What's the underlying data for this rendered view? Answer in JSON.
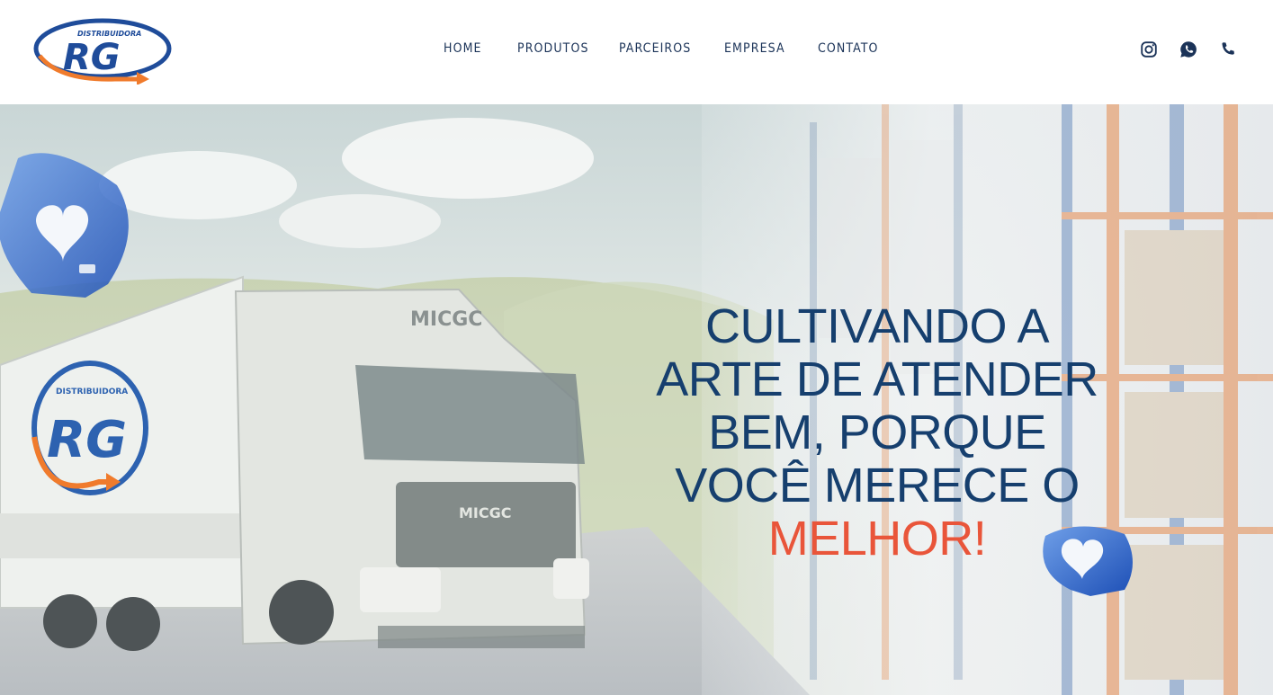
{
  "brand": {
    "logo_top_text": "DISTRIBUIDORA",
    "logo_letters": "RG",
    "truck_logo_top_text": "DISTRIBUIDORA",
    "truck_logo_letters": "RG"
  },
  "nav": {
    "items": [
      {
        "label": "HOME"
      },
      {
        "label": "PRODUTOS"
      },
      {
        "label": "PARCEIROS"
      },
      {
        "label": "EMPRESA"
      },
      {
        "label": "CONTATO"
      }
    ]
  },
  "socials": [
    {
      "icon": "instagram-icon"
    },
    {
      "icon": "whatsapp-icon"
    },
    {
      "icon": "phone-icon"
    }
  ],
  "hero": {
    "headline_lines": [
      "CULTIVANDO A",
      "ARTE DE ATENDER",
      "BEM, PORQUE",
      "VOCÊ MERECE O"
    ],
    "headline_accent": "MELHOR!",
    "truck_brand": "MICGC",
    "truck_front_brand": "MICGC"
  },
  "colors": {
    "navy": "#163f6e",
    "accent": "#e9553a",
    "nav_text": "#1b3358",
    "logo_blue": "#1f4c9a",
    "logo_orange": "#f07b2c"
  }
}
